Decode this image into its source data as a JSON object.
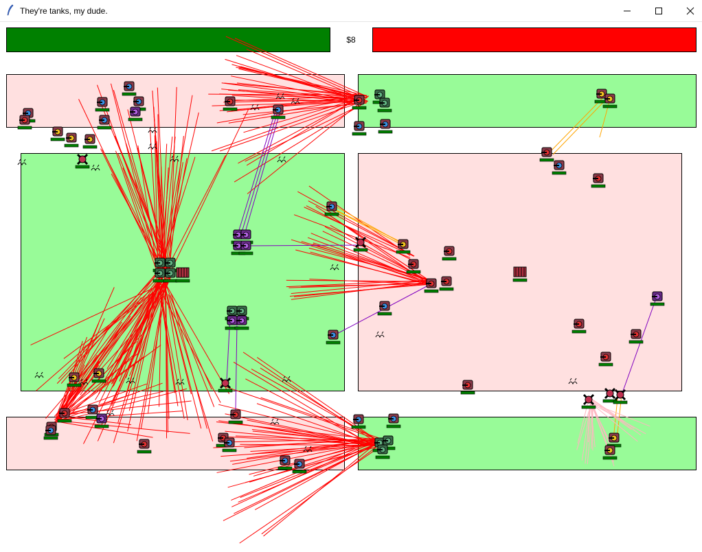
{
  "window": {
    "title": "They're tanks, my dude.",
    "controls": {
      "minimize": "minimize-icon",
      "maximize": "maximize-icon",
      "close": "close-icon"
    }
  },
  "hud": {
    "money": "$8",
    "player_health_color": "#008000",
    "enemy_health_color": "#ff0000"
  },
  "colors": {
    "friendly_zone": "#98fb98",
    "hostile_zone": "#ffe0e0",
    "laser_red": "#ff0000",
    "laser_orange": "#ffa500",
    "laser_purple": "#8000c0",
    "laser_pink": "#ffb6c1"
  },
  "units": {
    "types": [
      "blue-tank",
      "yellow-tank",
      "red-tank",
      "purple-tank",
      "green-tank",
      "spider-mech",
      "barracks"
    ],
    "has_health_bar": true
  }
}
